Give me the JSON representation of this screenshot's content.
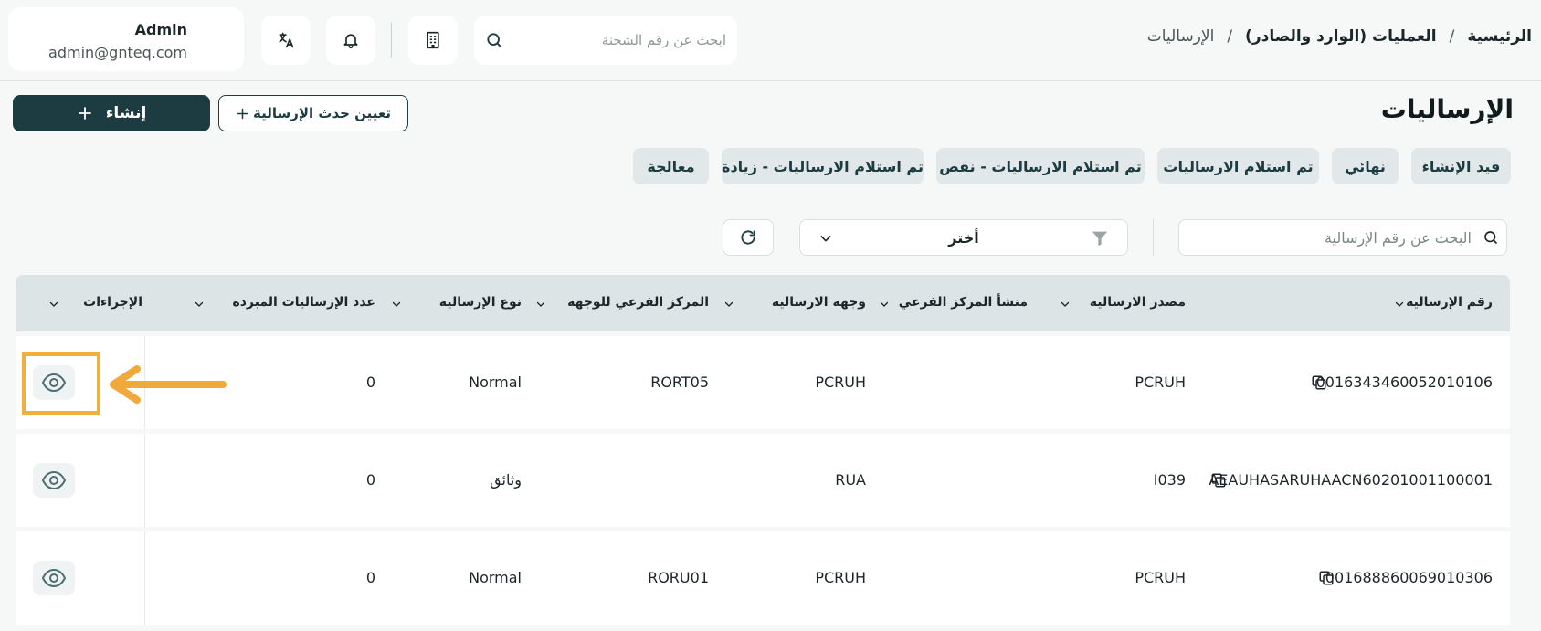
{
  "header": {
    "user": {
      "name": "Admin",
      "email": "admin@gnteq.com"
    },
    "search_placeholder": "ابحث عن رقم الشحنة",
    "icons": [
      "translate-icon",
      "bell-icon",
      "building-icon",
      "search-icon"
    ],
    "breadcrumb": {
      "home": "الرئيسية",
      "separator": "/",
      "operations": "العمليات (الوارد والصادر)",
      "current": "الإرساليات"
    }
  },
  "page": {
    "title": "الإرساليات",
    "create_label": "إنشاء",
    "assign_label": "تعيين حدث الإرسالية"
  },
  "tabs": [
    "قيد الإنشاء",
    "نهائي",
    "تم استلام الارساليات",
    "تم استلام الارساليات - نقص",
    "تم استلام الارساليات - زيادة",
    "معالجة"
  ],
  "filters": {
    "search_placeholder": "البحث عن رقم الإرسالية",
    "select_value": "أختر"
  },
  "table": {
    "columns": [
      "رقم الإرسالية",
      "مصدر الارسالية",
      "منشأ المركز الفرعي",
      "وجهة الارسالية",
      "المركز الفرعي للوجهة",
      "نوع الإرسالية",
      "عدد الإرساليات المبردة",
      "الإجراءات"
    ],
    "rows": [
      {
        "number": "0016343460052010106",
        "source": "PCRUH",
        "origin_branch": "",
        "destination": "PCRUH",
        "dest_branch": "RORT05",
        "type": "Normal",
        "cooled": "0"
      },
      {
        "number": "AEAUHASARUHAACN60201001100001",
        "source": "I039",
        "origin_branch": "",
        "destination": "RUA",
        "dest_branch": "",
        "type": "وثائق",
        "cooled": "0"
      },
      {
        "number": "001688860069010306",
        "source": "PCRUH",
        "origin_branch": "",
        "destination": "PCRUH",
        "dest_branch": "RORU01",
        "type": "Normal",
        "cooled": "0"
      }
    ]
  },
  "colors": {
    "primary": "#1c3c41",
    "tab_bg": "#e2e8e9",
    "header_bg": "#dde4e5",
    "annotation": "#f0b03a"
  }
}
